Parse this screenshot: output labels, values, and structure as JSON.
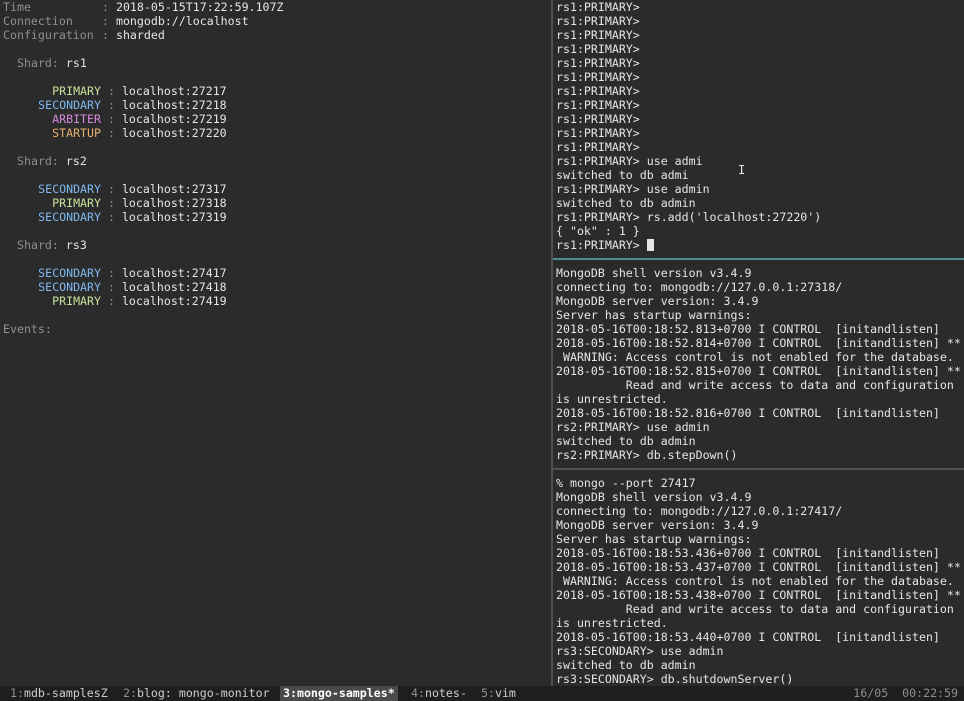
{
  "monitor": {
    "header": [
      {
        "key": "Time",
        "value": "2018-05-15T17:22:59.107Z"
      },
      {
        "key": "Connection",
        "value": "mongodb://localhost"
      },
      {
        "key": "Configuration",
        "value": "sharded"
      }
    ],
    "shard_label": "Shard:",
    "shards": [
      {
        "name": "rs1",
        "members": [
          {
            "role": "PRIMARY",
            "host": "localhost:27217"
          },
          {
            "role": "SECONDARY",
            "host": "localhost:27218"
          },
          {
            "role": "ARBITER",
            "host": "localhost:27219"
          },
          {
            "role": "STARTUP",
            "host": "localhost:27220"
          }
        ]
      },
      {
        "name": "rs2",
        "members": [
          {
            "role": "SECONDARY",
            "host": "localhost:27317"
          },
          {
            "role": "PRIMARY",
            "host": "localhost:27318"
          },
          {
            "role": "SECONDARY",
            "host": "localhost:27319"
          }
        ]
      },
      {
        "name": "rs3",
        "members": [
          {
            "role": "SECONDARY",
            "host": "localhost:27417"
          },
          {
            "role": "SECONDARY",
            "host": "localhost:27418"
          },
          {
            "role": "PRIMARY",
            "host": "localhost:27419"
          }
        ]
      }
    ],
    "events_label": "Events:"
  },
  "terminals": {
    "rs1": [
      "rs1:PRIMARY>",
      "rs1:PRIMARY>",
      "rs1:PRIMARY>",
      "rs1:PRIMARY>",
      "rs1:PRIMARY>",
      "rs1:PRIMARY>",
      "rs1:PRIMARY>",
      "rs1:PRIMARY>",
      "rs1:PRIMARY>",
      "rs1:PRIMARY>",
      "rs1:PRIMARY>",
      "rs1:PRIMARY> use admi",
      "switched to db admi",
      "rs1:PRIMARY> use admin",
      "switched to db admin",
      "rs1:PRIMARY> rs.add('localhost:27220')",
      "{ \"ok\" : 1 }"
    ],
    "rs1_prompt": "rs1:PRIMARY> ",
    "rs2": [
      "MongoDB shell version v3.4.9",
      "connecting to: mongodb://127.0.0.1:27318/",
      "MongoDB server version: 3.4.9",
      "Server has startup warnings:",
      "2018-05-16T00:18:52.813+0700 I CONTROL  [initandlisten]",
      "2018-05-16T00:18:52.814+0700 I CONTROL  [initandlisten] **",
      " WARNING: Access control is not enabled for the database.",
      "2018-05-16T00:18:52.815+0700 I CONTROL  [initandlisten] **",
      "          Read and write access to data and configuration",
      "is unrestricted.",
      "2018-05-16T00:18:52.816+0700 I CONTROL  [initandlisten]",
      "rs2:PRIMARY> use admin",
      "switched to db admin",
      "rs2:PRIMARY> db.stepDown()"
    ],
    "rs3": [
      "% mongo --port 27417",
      "MongoDB shell version v3.4.9",
      "connecting to: mongodb://127.0.0.1:27417/",
      "MongoDB server version: 3.4.9",
      "Server has startup warnings:",
      "2018-05-16T00:18:53.436+0700 I CONTROL  [initandlisten]",
      "2018-05-16T00:18:53.437+0700 I CONTROL  [initandlisten] **",
      " WARNING: Access control is not enabled for the database.",
      "2018-05-16T00:18:53.438+0700 I CONTROL  [initandlisten] **",
      "          Read and write access to data and configuration",
      "is unrestricted.",
      "2018-05-16T00:18:53.440+0700 I CONTROL  [initandlisten]",
      "rs3:SECONDARY> use admin",
      "switched to db admin",
      "rs3:SECONDARY> db.shutdownServer()"
    ]
  },
  "status_bar": {
    "windows": [
      {
        "num": "1",
        "name": "mdb-samplesZ",
        "active": false
      },
      {
        "num": "2",
        "name": "blog: mongo-monitor",
        "active": false
      },
      {
        "num": "3",
        "name": "mongo-samples*",
        "active": true
      },
      {
        "num": "4",
        "name": "notes-",
        "active": false
      },
      {
        "num": "5",
        "name": "vim",
        "active": false
      }
    ],
    "date": "16/05",
    "time": "00:22:59"
  },
  "colors": {
    "primary": "#c7e09a",
    "secondary": "#7fb8ef",
    "arbiter": "#d38bdc",
    "startup": "#e8b070",
    "background": "#2b2b2b",
    "active_pane_border": "#4a8f8f"
  },
  "icons": {
    "mouse_cursor": "text-ibeam-cursor-icon",
    "terminal_cursor": "block-cursor-icon"
  }
}
